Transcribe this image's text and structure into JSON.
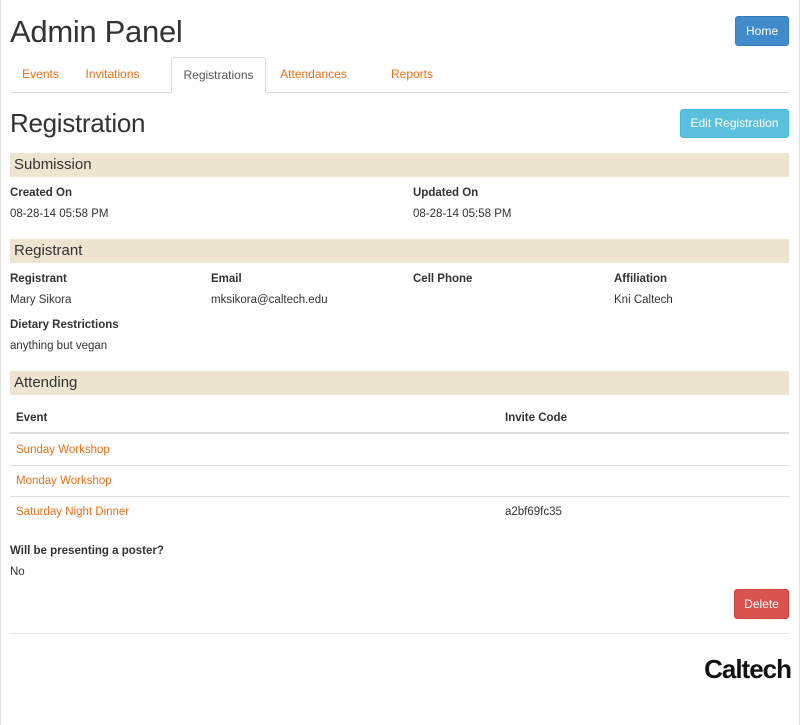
{
  "header": {
    "title": "Admin Panel",
    "home_label": "Home"
  },
  "tabs": [
    {
      "label": "Events"
    },
    {
      "label": "Invitations"
    },
    {
      "label": "Registrations"
    },
    {
      "label": "Attendances"
    },
    {
      "label": "Reports"
    }
  ],
  "active_tab": "Registrations",
  "page": {
    "heading": "Registration",
    "edit_label": "Edit Registration"
  },
  "submission": {
    "title": "Submission",
    "created_label": "Created On",
    "created_value": "08-28-14 05:58 PM",
    "updated_label": "Updated On",
    "updated_value": "08-28-14 05:58 PM"
  },
  "registrant": {
    "title": "Registrant",
    "name_label": "Registrant",
    "name_value": "Mary Sikora",
    "email_label": "Email",
    "email_value": "mksikora@caltech.edu",
    "phone_label": "Cell Phone",
    "phone_value": "",
    "affiliation_label": "Affiliation",
    "affiliation_value": "Kni Caltech",
    "dietary_label": "Dietary Restrictions",
    "dietary_value": "anything but vegan"
  },
  "attending": {
    "title": "Attending",
    "col_event": "Event",
    "col_invite": "Invite Code",
    "rows": [
      {
        "event": "Sunday Workshop",
        "invite": ""
      },
      {
        "event": "Monday Workshop",
        "invite": ""
      },
      {
        "event": "Saturday Night Dinner",
        "invite": "a2bf69fc35"
      }
    ],
    "poster_label": "Will be presenting a poster?",
    "poster_value": "No"
  },
  "delete_label": "Delete",
  "footer": {
    "logo": "Caltech"
  },
  "colors": {
    "link": "#e8701a",
    "band": "#ede5d0",
    "primary": "#428bca",
    "info": "#5bc0de",
    "danger": "#d9534f"
  }
}
